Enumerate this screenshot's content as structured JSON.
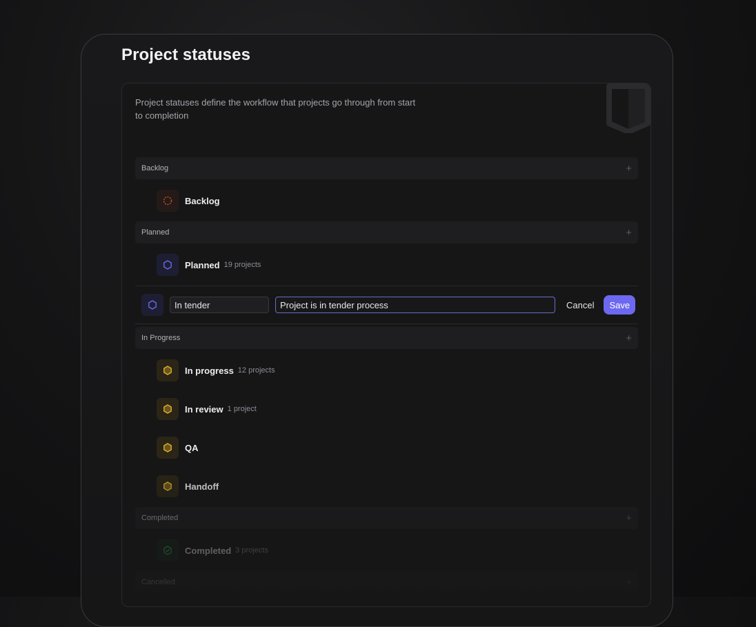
{
  "page": {
    "title": "Project statuses"
  },
  "card": {
    "description": "Project statuses define the workflow that projects go through from start to completion"
  },
  "groups": {
    "backlog": {
      "label": "Backlog",
      "statuses": [
        {
          "name": "Backlog",
          "count": "",
          "icon": "dashed-circle-icon",
          "color": "#c2552c"
        }
      ]
    },
    "planned": {
      "label": "Planned",
      "statuses": [
        {
          "name": "Planned",
          "count": "19 projects",
          "icon": "hexagon-outline-icon",
          "color": "#6b68e8"
        }
      ]
    },
    "in_progress": {
      "label": "In Progress",
      "statuses": [
        {
          "name": "In progress",
          "count": "12 projects",
          "icon": "hexagon-half-icon",
          "color": "#e2b02a"
        },
        {
          "name": "In review",
          "count": "1 project",
          "icon": "hexagon-half-icon",
          "color": "#e2b02a"
        },
        {
          "name": "QA",
          "count": "",
          "icon": "hexagon-half-icon",
          "color": "#e2b02a"
        },
        {
          "name": "Handoff",
          "count": "",
          "icon": "hexagon-half-icon",
          "color": "#e2b02a"
        }
      ]
    },
    "completed": {
      "label": "Completed",
      "statuses": [
        {
          "name": "Completed",
          "count": "3 projects",
          "icon": "check-hexagon-icon",
          "color": "#2fa35a"
        }
      ]
    },
    "cancelled": {
      "label": "Cancelled"
    }
  },
  "edit": {
    "name_value": "In tender",
    "description_value": "Project is in tender process",
    "icon": "hexagon-outline-icon",
    "cancel_label": "Cancel",
    "save_label": "Save"
  },
  "colors": {
    "accent": "#6d68f0",
    "backlog": "#c2552c",
    "planned": "#6b68e8",
    "in_progress": "#e2b02a",
    "completed": "#2fa35a"
  }
}
